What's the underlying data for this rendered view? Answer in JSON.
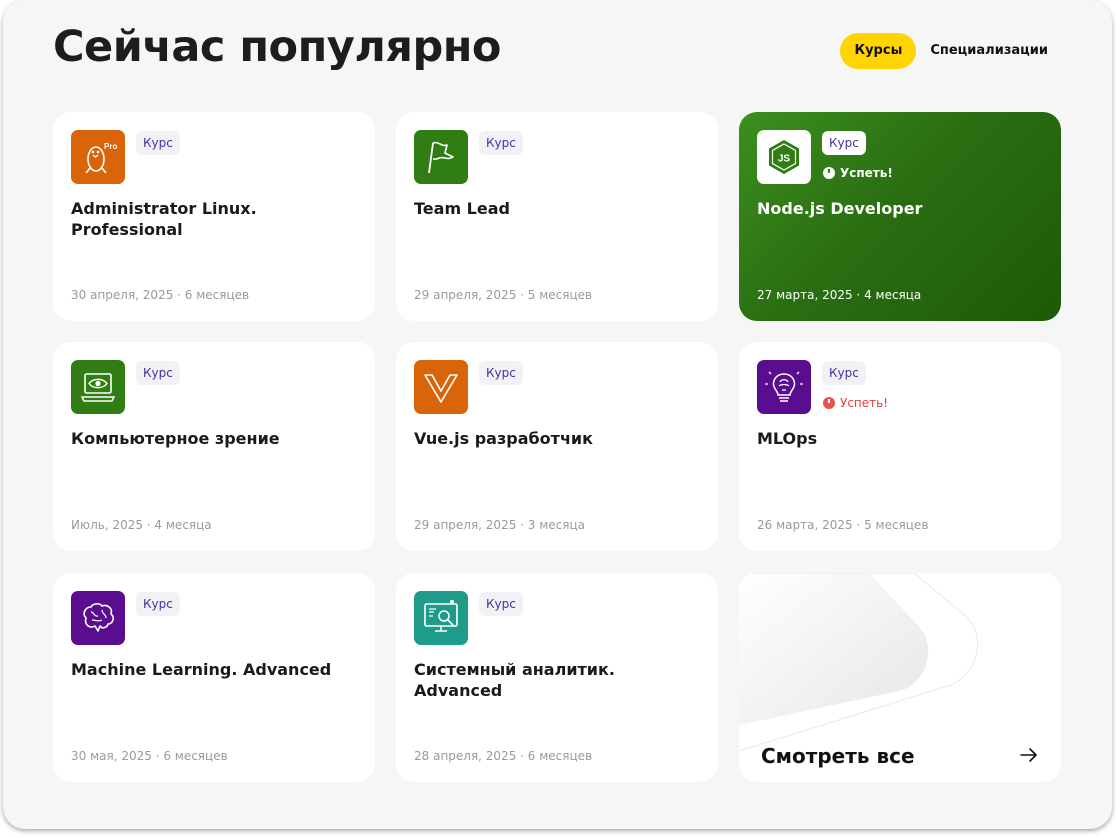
{
  "header": {
    "title": "Сейчас популярно"
  },
  "tabs": [
    {
      "label": "Курсы",
      "active": true
    },
    {
      "label": "Специализации",
      "active": false
    }
  ],
  "cards": [
    {
      "icon": "linux-penguin-pro-icon",
      "icon_bg": "#d9640a",
      "icon_text": "Pro",
      "badge": "Курс",
      "name": "Administrator Linux. Professional",
      "meta": "30 апреля, 2025 · 6 месяцев"
    },
    {
      "icon": "flag-icon",
      "icon_bg": "#2f7d13",
      "badge": "Курс",
      "name": "Team Lead",
      "meta": "29 апреля, 2025 · 5 месяцев"
    },
    {
      "icon": "nodejs-icon",
      "icon_bg": "#ffffff",
      "icon_text": "JS",
      "badge": "Курс",
      "hurry": "Успеть!",
      "name": "Node.js Developer",
      "meta": "27 марта, 2025 · 4 месяца",
      "featured": true
    },
    {
      "icon": "monitor-eye-icon",
      "icon_bg": "#2f7d13",
      "badge": "Курс",
      "name": "Компьютерное зрение",
      "meta": "Июль, 2025 · 4 месяца"
    },
    {
      "icon": "vue-icon",
      "icon_bg": "#d9640a",
      "badge": "Курс",
      "name": "Vue.js разработчик",
      "meta": "29 апреля, 2025 · 3 месяца"
    },
    {
      "icon": "lightbulb-brain-icon",
      "icon_bg": "#5a0d8f",
      "badge": "Курс",
      "hurry": "Успеть!",
      "name": "MLOps",
      "meta": "26 марта, 2025 · 5 месяцев"
    },
    {
      "icon": "brain-icon",
      "icon_bg": "#5a0d8f",
      "badge": "Курс",
      "name": "Machine Learning. Advanced",
      "meta": "30 мая, 2025 · 6 месяцев"
    },
    {
      "icon": "analytics-monitor-icon",
      "icon_bg": "#1f9b8a",
      "badge": "Курс",
      "name": "Системный аналитик. Advanced",
      "meta": "28 апреля, 2025 · 6 месяцев"
    }
  ],
  "see_all": {
    "label": "Смотреть все",
    "icon": "arrow-right-icon"
  },
  "colors": {
    "accent": "#ffd400",
    "badge_text": "#4b2ea0",
    "featured_bg": "#2a6e12",
    "hurry_red": "#e2403b"
  }
}
